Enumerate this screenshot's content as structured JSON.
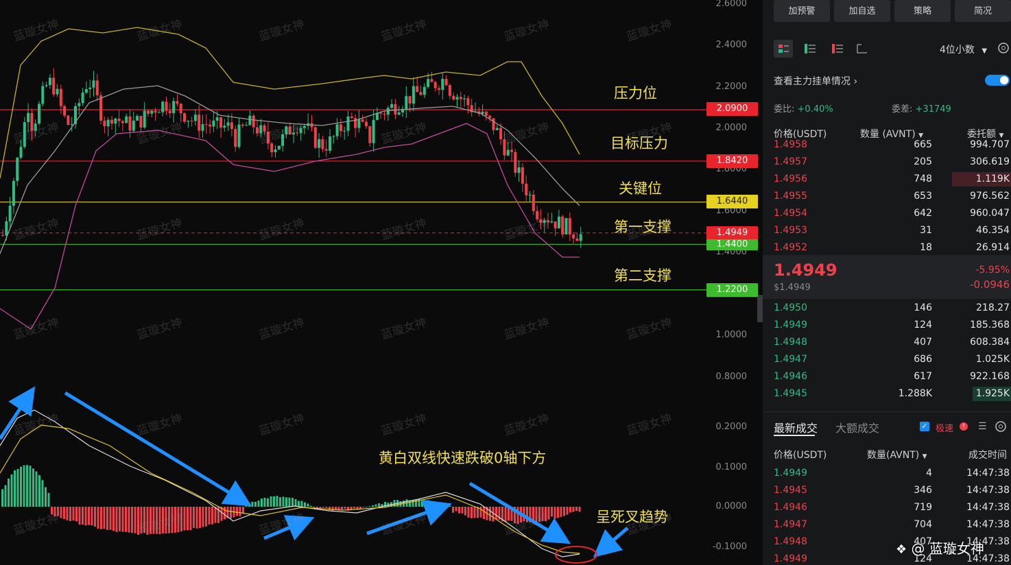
{
  "price_axis": [
    "2.6000",
    "2.4000",
    "2.2000",
    "2.0000",
    "1.8000",
    "1.6000",
    "1.4000",
    "1.0000",
    "0.8000"
  ],
  "macd_axis": [
    "0.2000",
    "0.1000",
    "0.0000",
    "-0.1000"
  ],
  "levels": [
    {
      "price": "2.0900",
      "color": "#e8242c",
      "kind": "red"
    },
    {
      "price": "1.8420",
      "color": "#e8242c",
      "kind": "red"
    },
    {
      "price": "1.6440",
      "color": "#e6d21e",
      "kind": "yellow"
    },
    {
      "price": "1.4949",
      "color": "#e8242c",
      "kind": "current"
    },
    {
      "price": "1.4400",
      "color": "#3dbb2c",
      "kind": "green"
    },
    {
      "price": "1.2200",
      "color": "#3dbb2c",
      "kind": "green"
    }
  ],
  "annotations": {
    "pressure": "压力位",
    "target_pressure": "目标压力",
    "key_level": "关键位",
    "support1": "第一支撑",
    "support2": "第二支撑",
    "macd_note": "黄白双线快速跌破0轴下方",
    "death_cross": "呈死叉趋势"
  },
  "watermark": "蓝璇女神",
  "panel": {
    "top_buttons": [
      "加预警",
      "加自选",
      "策略",
      "简况"
    ],
    "decimals": "4位小数",
    "main_orders": "查看主力挂单情况",
    "ratio_label": "委比:",
    "ratio_value": "+0.40%",
    "diff_label": "委差:",
    "diff_value": "+31749",
    "col_price": "价格(USDT)",
    "col_qty": "数量 (AVNT)",
    "col_total": "委托额",
    "asks": [
      {
        "p": "1.4958",
        "q": "665",
        "t": "994.707"
      },
      {
        "p": "1.4957",
        "q": "205",
        "t": "306.619"
      },
      {
        "p": "1.4956",
        "q": "748",
        "t": "1.119K"
      },
      {
        "p": "1.4955",
        "q": "653",
        "t": "976.562"
      },
      {
        "p": "1.4954",
        "q": "642",
        "t": "960.047"
      },
      {
        "p": "1.4953",
        "q": "31",
        "t": "46.354"
      },
      {
        "p": "1.4952",
        "q": "18",
        "t": "26.914"
      }
    ],
    "last_price": "1.4949",
    "last_usd": "$1.4949",
    "change_pct": "-5.95%",
    "change_abs": "-0.0946",
    "bids": [
      {
        "p": "1.4950",
        "q": "146",
        "t": "218.27"
      },
      {
        "p": "1.4949",
        "q": "124",
        "t": "185.368"
      },
      {
        "p": "1.4948",
        "q": "407",
        "t": "608.384"
      },
      {
        "p": "1.4947",
        "q": "686",
        "t": "1.025K"
      },
      {
        "p": "1.4946",
        "q": "617",
        "t": "922.168"
      },
      {
        "p": "1.4945",
        "q": "1.288K",
        "t": "1.925K"
      }
    ],
    "trades_tab": "最新成交",
    "large_tab": "大额成交",
    "speed_label": "极速",
    "col_tprice": "价格(USDT)",
    "col_tqty": "数量(AVNT)",
    "col_time": "成交时间",
    "trades": [
      {
        "p": "1.4949",
        "q": "4",
        "t": "14:47:38",
        "side": "buy"
      },
      {
        "p": "1.4945",
        "q": "346",
        "t": "14:47:38",
        "side": "sell"
      },
      {
        "p": "1.4946",
        "q": "719",
        "t": "14:47:38",
        "side": "sell"
      },
      {
        "p": "1.4947",
        "q": "704",
        "t": "14:47:38",
        "side": "sell"
      },
      {
        "p": "1.4948",
        "q": "407",
        "t": "14:47:38",
        "side": "sell"
      },
      {
        "p": "1.4949",
        "q": "124",
        "t": "14:47:38",
        "side": "sell"
      }
    ],
    "brand": "@ 蓝璇女神"
  },
  "colors": {
    "up": "#2ebd85",
    "down": "#f0414b",
    "boll_upper": "#c9b21c",
    "boll_lower": "#c14a9c",
    "boll_mid": "#9a9a9a"
  }
}
